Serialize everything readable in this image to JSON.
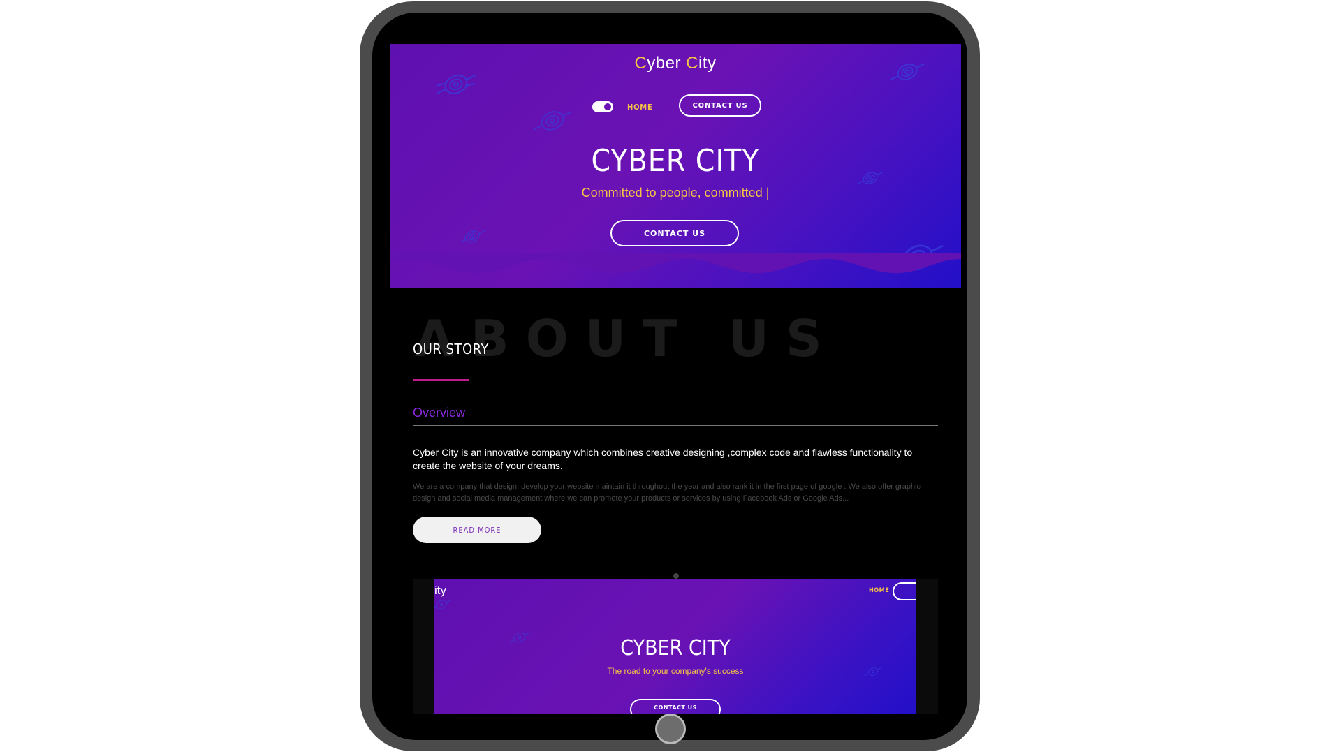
{
  "hero": {
    "brand": "Cyber City",
    "nav_home": "HOME",
    "nav_contact": "CONTACT US",
    "title": "CYBER CITY",
    "subtitle": "Committed to people, committed |",
    "cta": "CONTACT US"
  },
  "about": {
    "background_text": "ABOUT US",
    "title": "OUR STORY",
    "tab_label": "Overview",
    "lead": "Cyber City is an innovative company which combines creative designing ,complex code and flawless functionality to create the website of your dreams.",
    "body": "We are a company that design, develop your website maintain it throughout the year and also rank it in the first page of google . We also offer graphic design and social media management where we can promote your products or services by using Facebook Ads or Google Ads...",
    "read_more": "READ MORE"
  },
  "preview": {
    "brand_partial": "ity",
    "nav_home": "HOME",
    "title": "CYBER CITY",
    "subtitle": "The road to your company's success",
    "cta": "CONTACT US"
  },
  "colors": {
    "accent_yellow": "#f6c445",
    "accent_purple": "#8a2be2",
    "accent_magenta": "#c01c8c",
    "hero_start": "#6a12b4",
    "hero_end": "#2210c8"
  },
  "icons": [
    "toggle-switch-icon",
    "tech-chip-icon"
  ]
}
